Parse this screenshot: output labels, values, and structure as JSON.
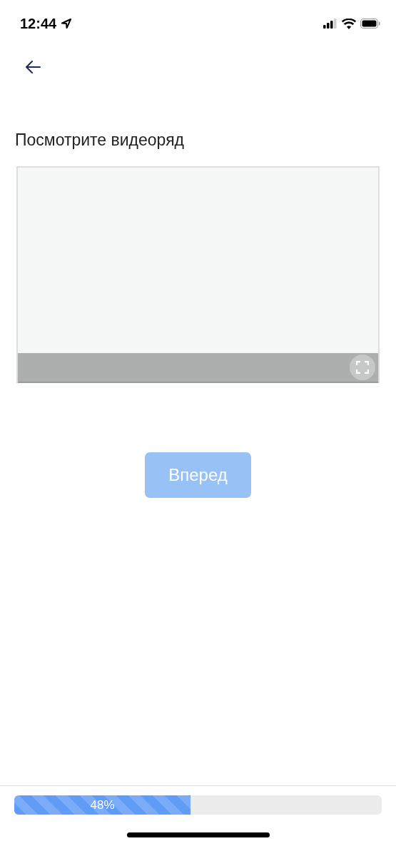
{
  "status_bar": {
    "time": "12:44"
  },
  "title": "Посмотрите видеоряд",
  "next_button": {
    "label": "Вперед",
    "disabled": true
  },
  "progress": {
    "level": 0.48,
    "label": "48%"
  }
}
